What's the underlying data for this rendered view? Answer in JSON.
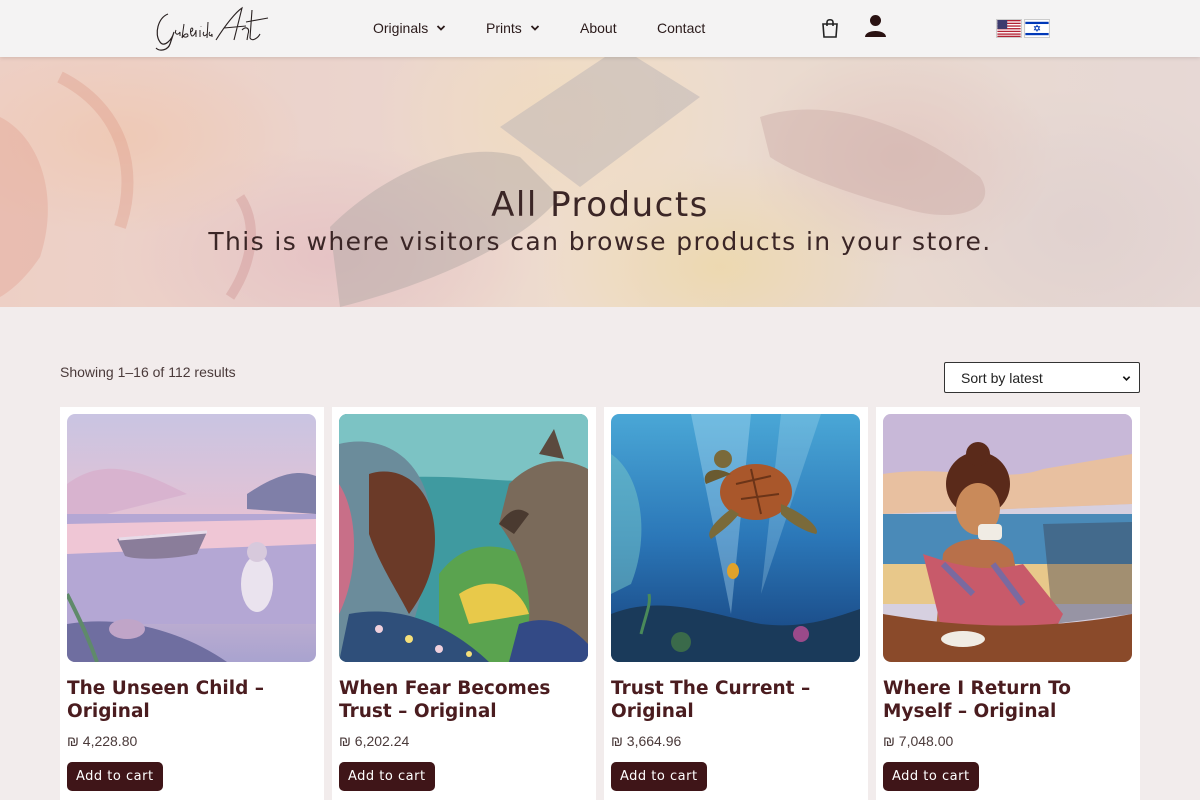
{
  "header": {
    "logo_text": "GabrielaArt",
    "nav": [
      {
        "label": "Originals",
        "has_dropdown": true
      },
      {
        "label": "Prints",
        "has_dropdown": true
      },
      {
        "label": "About",
        "has_dropdown": false
      },
      {
        "label": "Contact",
        "has_dropdown": false
      }
    ],
    "icons": [
      "shopping-bag-icon",
      "user-icon",
      "flag-us-icon",
      "flag-israel-icon"
    ]
  },
  "hero": {
    "title": "All Products",
    "subtitle": "This is where visitors can browse products in your store."
  },
  "shop": {
    "results_text": "Showing 1–16 of 112 results",
    "sort_selected": "Sort by latest"
  },
  "products": [
    {
      "title": "The Unseen Child – Original",
      "price": "₪ 4,228.80",
      "button": "Add to cart",
      "image": "painting of a girl by a lake with a rowboat"
    },
    {
      "title": "When Fear Becomes Trust – Original",
      "price": "₪ 6,202.24",
      "button": "Add to cart",
      "image": "painting of a woman facing a wolf"
    },
    {
      "title": "Trust The Current – Original",
      "price": "₪ 3,664.96",
      "button": "Add to cart",
      "image": "painting of a sea turtle underwater"
    },
    {
      "title": "Where I Return To Myself – Original",
      "price": "₪ 7,048.00",
      "button": "Add to cart",
      "image": "painting of a woman with a coffee cup by the sea"
    }
  ],
  "colors": {
    "accent": "#3f1518",
    "title": "#4a1c1f",
    "background": "#f2ecec"
  }
}
